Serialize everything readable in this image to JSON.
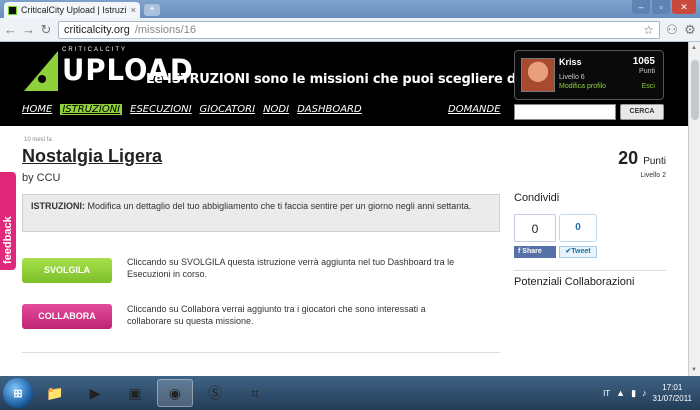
{
  "browser": {
    "tab_title": "CriticalCity Upload | Istruzi",
    "tab_close": "×",
    "new_tab": "+",
    "url_host": "criticalcity.org",
    "url_path": "/missions/16",
    "window_controls": [
      "–",
      "▫",
      "✕"
    ]
  },
  "header": {
    "logo_small": "CRITICALCITY",
    "logo_big": "UPLOAD",
    "tagline": "Le ISTRUZIONI sono le missioni che puoi scegliere di svolgere",
    "user": {
      "name": "Kriss",
      "level": "Livello 6",
      "edit_profile": "Modifica profilo",
      "points": "1065",
      "points_label": "Punti",
      "logout": "Esci"
    },
    "menu": [
      {
        "label": "HOME",
        "active": false
      },
      {
        "label": "ISTRUZIONI",
        "active": true
      },
      {
        "label": "ESECUZIONI",
        "active": false
      },
      {
        "label": "GIOCATORI",
        "active": false
      },
      {
        "label": "NODI",
        "active": false
      },
      {
        "label": "DASHBOARD",
        "active": false
      }
    ],
    "menu_right": "DOMANDE",
    "search_button": "CERCA"
  },
  "mission": {
    "ago": "10 mesi fa",
    "title": "Nostalgia Ligera",
    "by": "by CCU",
    "points": "20",
    "points_label": "Punti",
    "level": "Livello 2",
    "instruction_label": "ISTRUZIONI:",
    "instruction_text": " Modifica un dettaglio del tuo abbigliamento che ti faccia sentire per un giorno negli anni settanta.",
    "svolgila_label": "SVOLGILA",
    "svolgila_desc": "Cliccando su SVOLGILA questa istruzione verrà aggiunta nel tuo Dashboard tra le Esecuzioni in corso.",
    "collabora_label": "COLLABORA",
    "collabora_desc": "Cliccando su Collabora verrai aggiunto tra i giocatori che sono interessati a collaborare su questa missione."
  },
  "feedback_tab": "feedback",
  "sidebar": {
    "share_title": "Condividi",
    "fb_count": "0",
    "fb_share": "Share",
    "tw_count": "0",
    "tw_button": "Tweet",
    "collab_title": "Potenziali Collaborazioni"
  },
  "taskbar": {
    "language": "IT",
    "time": "17:01",
    "date": "31/07/2011"
  },
  "colors": {
    "accent_green": "#8ed13a",
    "accent_pink": "#e0287a",
    "header_bg": "#000000"
  }
}
